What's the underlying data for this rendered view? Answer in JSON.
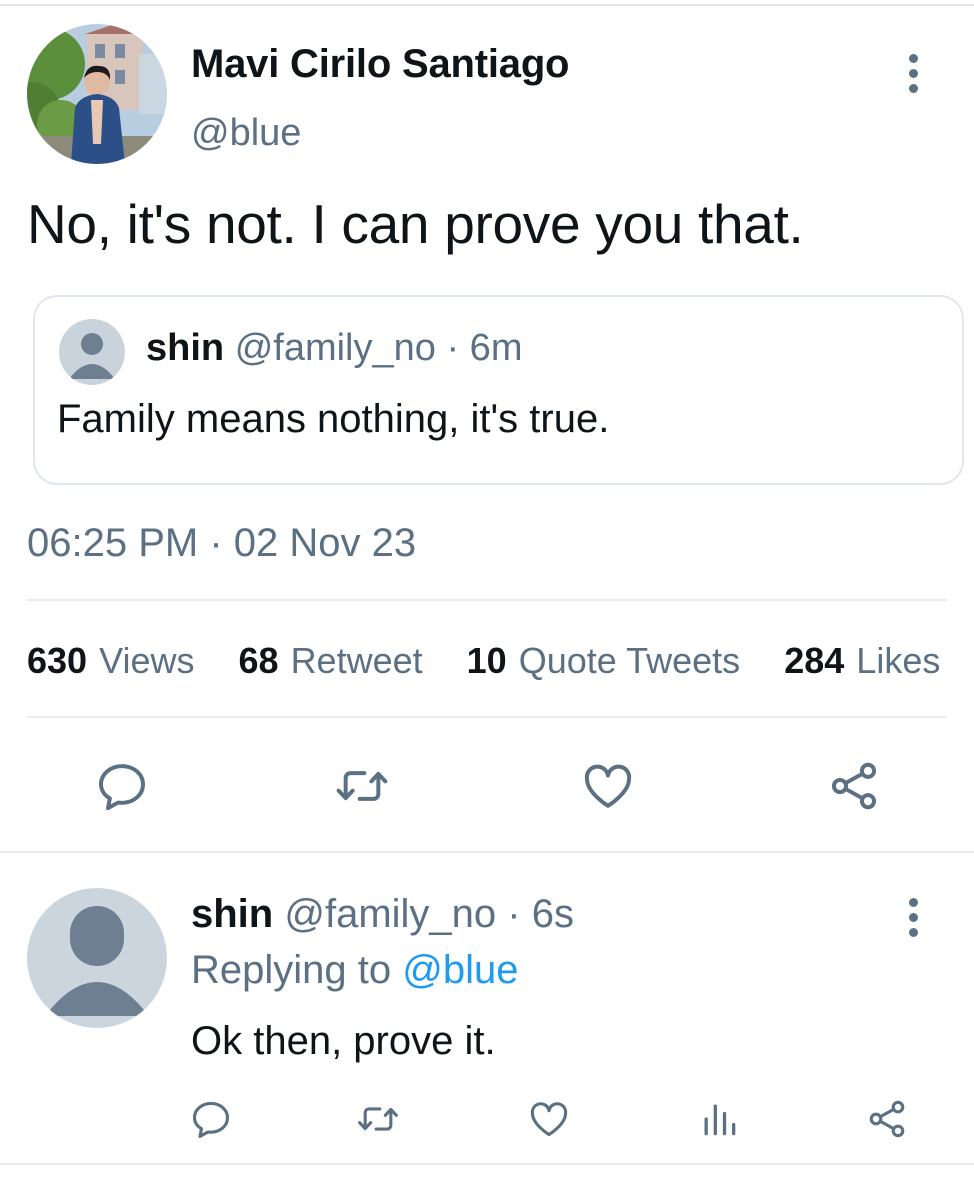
{
  "colors": {
    "text_primary": "#0f1419",
    "text_secondary": "#5b7083",
    "link": "#1d9bf0",
    "divider": "#e6ecf0"
  },
  "main_tweet": {
    "display_name": "Mavi Cirilo Santiago",
    "handle": "@blue",
    "text": "No, it's not. I can prove you that.",
    "timestamp": "06:25 PM · 02 Nov 23",
    "stats": [
      {
        "count": "630",
        "label": "Views"
      },
      {
        "count": "68",
        "label": "Retweet"
      },
      {
        "count": "10",
        "label": "Quote Tweets"
      },
      {
        "count": "284",
        "label": "Likes"
      }
    ]
  },
  "quoted_tweet": {
    "name": "shin",
    "handle": "@family_no",
    "time": "· 6m",
    "text": "Family means nothing, it's true."
  },
  "reply_tweet": {
    "name": "shin",
    "handle": "@family_no",
    "time": "· 6s",
    "replying_prefix": "Replying to",
    "replying_to": "@blue",
    "text": "Ok then, prove it."
  },
  "icons": {
    "main_actions": [
      "reply-icon",
      "retweet-icon",
      "like-icon",
      "share-icon"
    ],
    "reply_actions": [
      "reply-icon",
      "retweet-icon",
      "like-icon",
      "views-icon",
      "share-icon"
    ]
  }
}
